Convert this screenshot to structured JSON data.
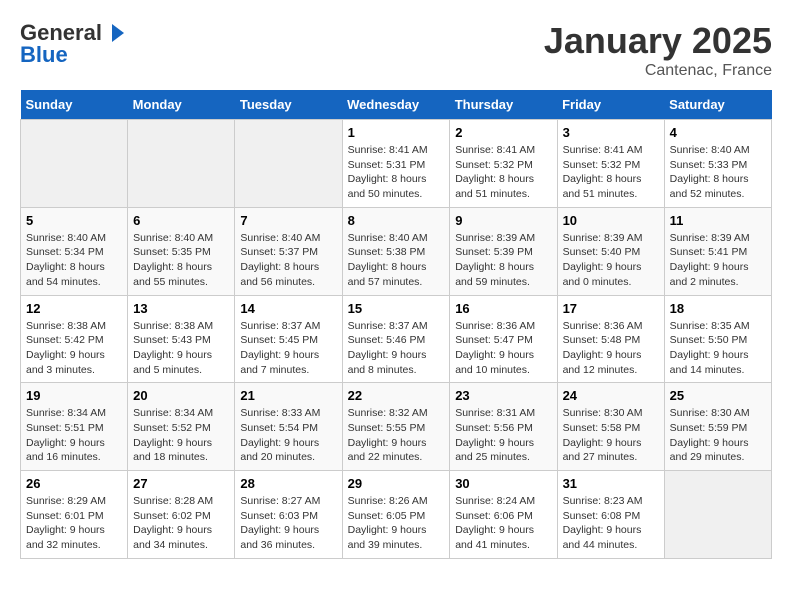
{
  "logo": {
    "general": "General",
    "blue": "Blue"
  },
  "title": "January 2025",
  "subtitle": "Cantenac, France",
  "days_of_week": [
    "Sunday",
    "Monday",
    "Tuesday",
    "Wednesday",
    "Thursday",
    "Friday",
    "Saturday"
  ],
  "weeks": [
    [
      {
        "day": "",
        "info": ""
      },
      {
        "day": "",
        "info": ""
      },
      {
        "day": "",
        "info": ""
      },
      {
        "day": "1",
        "info": "Sunrise: 8:41 AM\nSunset: 5:31 PM\nDaylight: 8 hours and 50 minutes."
      },
      {
        "day": "2",
        "info": "Sunrise: 8:41 AM\nSunset: 5:32 PM\nDaylight: 8 hours and 51 minutes."
      },
      {
        "day": "3",
        "info": "Sunrise: 8:41 AM\nSunset: 5:32 PM\nDaylight: 8 hours and 51 minutes."
      },
      {
        "day": "4",
        "info": "Sunrise: 8:40 AM\nSunset: 5:33 PM\nDaylight: 8 hours and 52 minutes."
      }
    ],
    [
      {
        "day": "5",
        "info": "Sunrise: 8:40 AM\nSunset: 5:34 PM\nDaylight: 8 hours and 54 minutes."
      },
      {
        "day": "6",
        "info": "Sunrise: 8:40 AM\nSunset: 5:35 PM\nDaylight: 8 hours and 55 minutes."
      },
      {
        "day": "7",
        "info": "Sunrise: 8:40 AM\nSunset: 5:37 PM\nDaylight: 8 hours and 56 minutes."
      },
      {
        "day": "8",
        "info": "Sunrise: 8:40 AM\nSunset: 5:38 PM\nDaylight: 8 hours and 57 minutes."
      },
      {
        "day": "9",
        "info": "Sunrise: 8:39 AM\nSunset: 5:39 PM\nDaylight: 8 hours and 59 minutes."
      },
      {
        "day": "10",
        "info": "Sunrise: 8:39 AM\nSunset: 5:40 PM\nDaylight: 9 hours and 0 minutes."
      },
      {
        "day": "11",
        "info": "Sunrise: 8:39 AM\nSunset: 5:41 PM\nDaylight: 9 hours and 2 minutes."
      }
    ],
    [
      {
        "day": "12",
        "info": "Sunrise: 8:38 AM\nSunset: 5:42 PM\nDaylight: 9 hours and 3 minutes."
      },
      {
        "day": "13",
        "info": "Sunrise: 8:38 AM\nSunset: 5:43 PM\nDaylight: 9 hours and 5 minutes."
      },
      {
        "day": "14",
        "info": "Sunrise: 8:37 AM\nSunset: 5:45 PM\nDaylight: 9 hours and 7 minutes."
      },
      {
        "day": "15",
        "info": "Sunrise: 8:37 AM\nSunset: 5:46 PM\nDaylight: 9 hours and 8 minutes."
      },
      {
        "day": "16",
        "info": "Sunrise: 8:36 AM\nSunset: 5:47 PM\nDaylight: 9 hours and 10 minutes."
      },
      {
        "day": "17",
        "info": "Sunrise: 8:36 AM\nSunset: 5:48 PM\nDaylight: 9 hours and 12 minutes."
      },
      {
        "day": "18",
        "info": "Sunrise: 8:35 AM\nSunset: 5:50 PM\nDaylight: 9 hours and 14 minutes."
      }
    ],
    [
      {
        "day": "19",
        "info": "Sunrise: 8:34 AM\nSunset: 5:51 PM\nDaylight: 9 hours and 16 minutes."
      },
      {
        "day": "20",
        "info": "Sunrise: 8:34 AM\nSunset: 5:52 PM\nDaylight: 9 hours and 18 minutes."
      },
      {
        "day": "21",
        "info": "Sunrise: 8:33 AM\nSunset: 5:54 PM\nDaylight: 9 hours and 20 minutes."
      },
      {
        "day": "22",
        "info": "Sunrise: 8:32 AM\nSunset: 5:55 PM\nDaylight: 9 hours and 22 minutes."
      },
      {
        "day": "23",
        "info": "Sunrise: 8:31 AM\nSunset: 5:56 PM\nDaylight: 9 hours and 25 minutes."
      },
      {
        "day": "24",
        "info": "Sunrise: 8:30 AM\nSunset: 5:58 PM\nDaylight: 9 hours and 27 minutes."
      },
      {
        "day": "25",
        "info": "Sunrise: 8:30 AM\nSunset: 5:59 PM\nDaylight: 9 hours and 29 minutes."
      }
    ],
    [
      {
        "day": "26",
        "info": "Sunrise: 8:29 AM\nSunset: 6:01 PM\nDaylight: 9 hours and 32 minutes."
      },
      {
        "day": "27",
        "info": "Sunrise: 8:28 AM\nSunset: 6:02 PM\nDaylight: 9 hours and 34 minutes."
      },
      {
        "day": "28",
        "info": "Sunrise: 8:27 AM\nSunset: 6:03 PM\nDaylight: 9 hours and 36 minutes."
      },
      {
        "day": "29",
        "info": "Sunrise: 8:26 AM\nSunset: 6:05 PM\nDaylight: 9 hours and 39 minutes."
      },
      {
        "day": "30",
        "info": "Sunrise: 8:24 AM\nSunset: 6:06 PM\nDaylight: 9 hours and 41 minutes."
      },
      {
        "day": "31",
        "info": "Sunrise: 8:23 AM\nSunset: 6:08 PM\nDaylight: 9 hours and 44 minutes."
      },
      {
        "day": "",
        "info": ""
      }
    ]
  ]
}
